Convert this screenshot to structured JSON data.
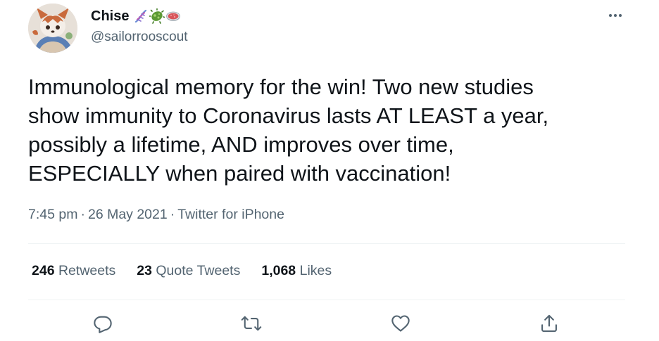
{
  "author": {
    "display_name": "Chise",
    "handle": "@sailorrooscout",
    "name_emojis": [
      "dna-icon",
      "microbe-icon",
      "petri-dish-icon"
    ]
  },
  "tweet": {
    "text": "Immunological memory for the win! Two new studies\nshow immunity to Coronavirus lasts AT LEAST a year,\npossibly a lifetime, AND improves over time,\nESPECIALLY when paired with vaccination!",
    "time": "7:45 pm",
    "date": "26 May 2021",
    "source": "Twitter for iPhone",
    "separator": "·"
  },
  "stats": {
    "retweets_count": "246",
    "retweets_label": "Retweets",
    "quotes_count": "23",
    "quotes_label": "Quote Tweets",
    "likes_count": "1,068",
    "likes_label": "Likes"
  },
  "actions": [
    "reply-icon",
    "retweet-icon",
    "like-icon",
    "share-icon"
  ],
  "colors": {
    "text_primary": "#0f1419",
    "text_secondary": "#536471",
    "divider": "#eff3f4",
    "icon": "#536471"
  }
}
